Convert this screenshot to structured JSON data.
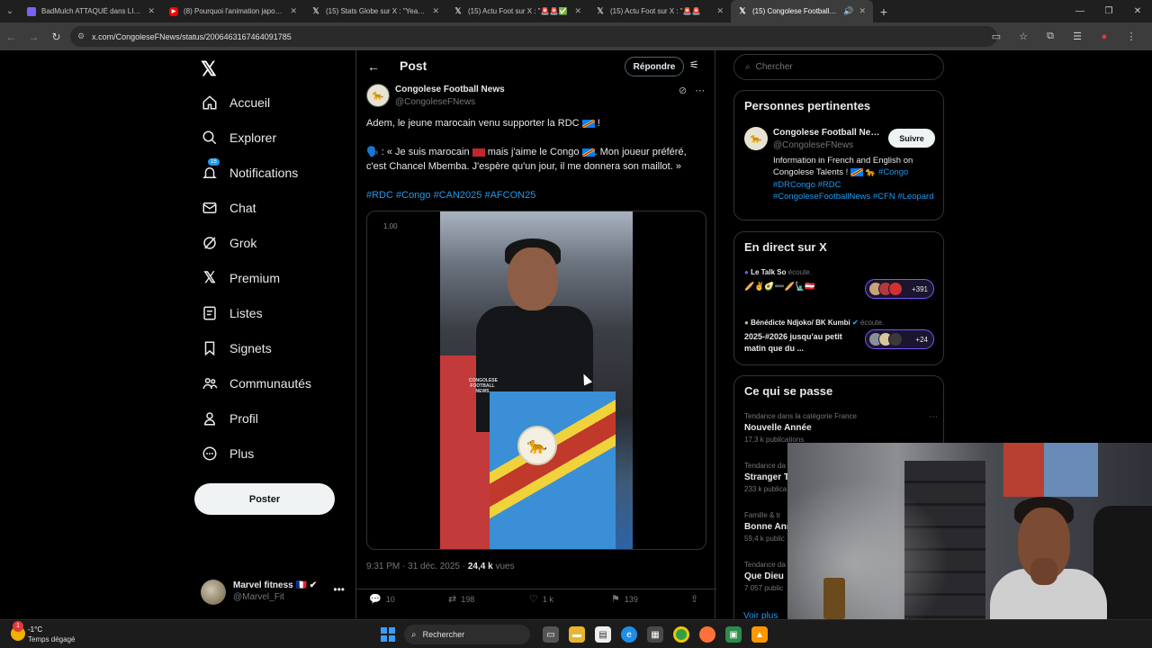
{
  "browser": {
    "tabs": [
      {
        "label": "BadMulch ATTAQUÉ dans LIBÉ",
        "icon": "document-icon",
        "color": "#7b61ff"
      },
      {
        "label": "(8) Pourquoi l'animation japonaise",
        "icon": "youtube-icon",
        "color": "#ff0000"
      },
      {
        "label": "(15) Stats Globe sur X : \"Year W",
        "icon": "x-icon",
        "color": "#ffffff"
      },
      {
        "label": "(15) Actu Foot sur X : \"🚨🚨✅",
        "icon": "x-icon",
        "color": "#ffffff"
      },
      {
        "label": "(15) Actu Foot sur X : \"🚨🚨",
        "icon": "x-icon",
        "color": "#ffffff"
      },
      {
        "label": "(15) Congolese Football Ne",
        "icon": "x-icon",
        "color": "#ffffff"
      }
    ],
    "url": "x.com/CongoleseFNews/status/2006463167464091785"
  },
  "nav": {
    "items": [
      {
        "label": "Accueil",
        "icon": "home-icon",
        "glyph": "⌂"
      },
      {
        "label": "Explorer",
        "icon": "search-icon",
        "glyph": "⌕"
      },
      {
        "label": "Notifications",
        "icon": "bell-icon",
        "glyph": "🔔",
        "badge": "15"
      },
      {
        "label": "Chat",
        "icon": "mail-icon",
        "glyph": "✉"
      },
      {
        "label": "Grok",
        "icon": "grok-icon",
        "glyph": "⊘"
      },
      {
        "label": "Premium",
        "icon": "x-premium-icon",
        "glyph": "𝕏"
      },
      {
        "label": "Listes",
        "icon": "list-icon",
        "glyph": "☰"
      },
      {
        "label": "Signets",
        "icon": "bookmark-icon",
        "glyph": "⚑"
      },
      {
        "label": "Communautés",
        "icon": "communities-icon",
        "glyph": "👥"
      },
      {
        "label": "Profil",
        "icon": "profile-icon",
        "glyph": "👤"
      },
      {
        "label": "Plus",
        "icon": "more-circle-icon",
        "glyph": "⋯"
      }
    ],
    "post_button": "Poster",
    "account": {
      "name": "Marvel fitness 🇫🇷 ✔",
      "handle": "@Marvel_Fit"
    }
  },
  "post": {
    "header_title": "Post",
    "reply_button": "Répondre",
    "author_name": "Congolese Football News",
    "author_handle": "@CongoleseFNews",
    "text_line1": "Adem, le jeune marocain venu supporter la RDC",
    "quote_a": "🗣️ : « Je suis marocain",
    "quote_b": "mais j'aime le Congo",
    "quote_c": ". Mon joueur préféré,",
    "quote_line2": "c'est Chancel Mbemba. J'espère qu'un jour, il me donnera son maillot. »",
    "hashtags": "#RDC #Congo #CAN2025 #AFCON25",
    "video_speed": "1.00",
    "video_watermark": "CONGOLESE FOOTBALL NEWS",
    "time": "9:31 PM · 31 déc. 2025 ·",
    "views_count": "24,4 k",
    "views_label": "vues",
    "stats": {
      "replies": "10",
      "reposts": "198",
      "likes": "1 k",
      "bookmarks": "139"
    }
  },
  "sidebar": {
    "search_placeholder": "Chercher",
    "relevant": {
      "title": "Personnes pertinentes",
      "name": "Congolese Football News",
      "handle": "@CongoleseFNews",
      "follow": "Suivre",
      "bio_text": "Information in French and English on Congolese Talents !",
      "bio_tags": "#Congo #DRCongo #RDC #CongoleseFootballNews #CFN #Leopard"
    },
    "live": {
      "title": "En direct sur X",
      "items": [
        {
          "host": "Le Talk So",
          "status": "écoute.",
          "title": "🥖✌️🥑➖🥖🗽🇦🇹",
          "count": "+391"
        },
        {
          "host": "Bénédicte Ndjoko/ BK Kumbi",
          "status": "écoute.",
          "title": "2025-#2026 jusqu'au petit matin que du ...",
          "count": "+24"
        }
      ]
    },
    "trends": {
      "title": "Ce qui se passe",
      "items": [
        {
          "context": "Tendance dans la catégorie France",
          "name": "Nouvelle Année",
          "count": "17,3 k publications"
        },
        {
          "context": "Tendance da",
          "name": "Stranger T",
          "count": "233 k publica"
        },
        {
          "context": "Famille & tr",
          "name": "Bonne Ann",
          "count": "59,4 k public"
        },
        {
          "context": "Tendance da",
          "name": "Que Dieu",
          "count": "7 057 public"
        }
      ],
      "see_more": "Voir plus"
    }
  },
  "taskbar": {
    "temp": "-1°C",
    "weather_desc": "Temps dégagé",
    "weather_badge": "1",
    "search": "Rechercher"
  }
}
